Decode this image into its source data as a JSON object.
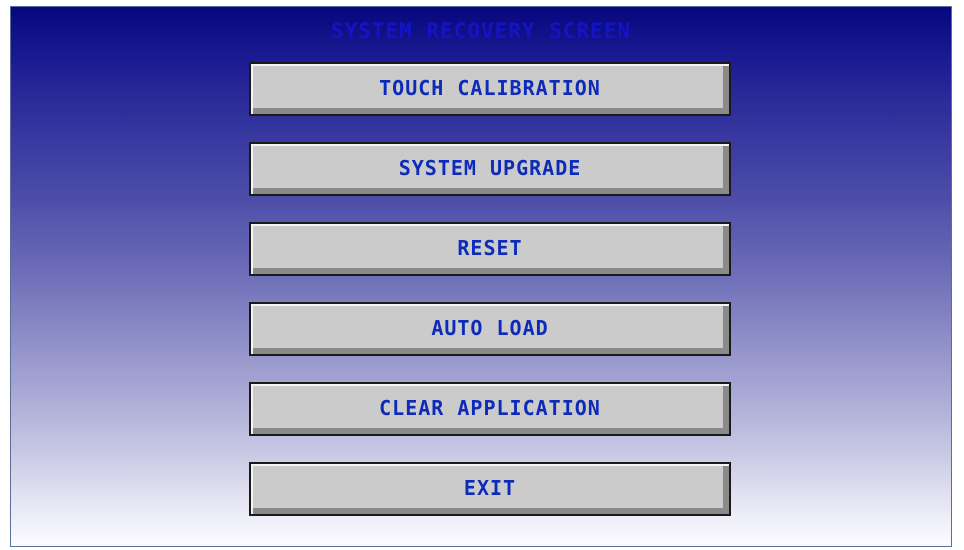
{
  "screen": {
    "title": "SYSTEM RECOVERY SCREEN"
  },
  "buttons": [
    {
      "label": "TOUCH CALIBRATION"
    },
    {
      "label": "SYSTEM UPGRADE"
    },
    {
      "label": "RESET"
    },
    {
      "label": "AUTO LOAD"
    },
    {
      "label": "CLEAR APPLICATION"
    },
    {
      "label": "EXIT"
    }
  ],
  "colors": {
    "gradient_top": "#06067e",
    "gradient_bottom": "#fbfbff",
    "title_text": "#1414c4",
    "button_face": "#cbcbcb",
    "button_text": "#0d2ab8"
  }
}
